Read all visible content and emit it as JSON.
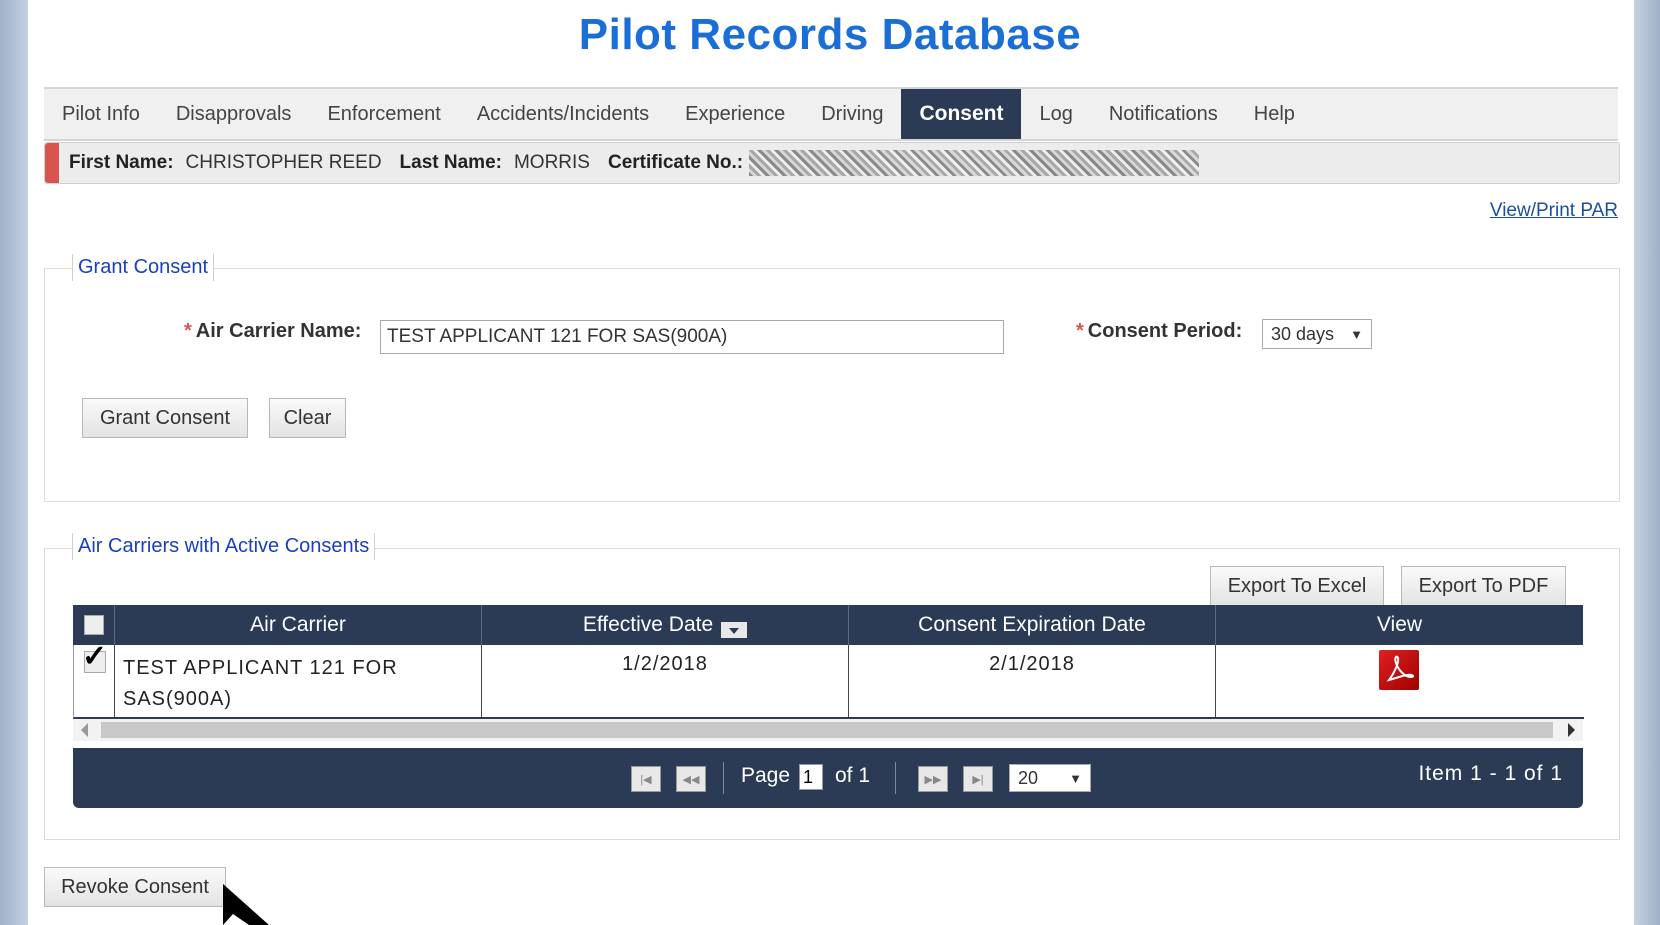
{
  "title": "Pilot Records Database",
  "nav": {
    "items": [
      "Pilot Info",
      "Disapprovals",
      "Enforcement",
      "Accidents/Incidents",
      "Experience",
      "Driving",
      "Consent",
      "Log",
      "Notifications",
      "Help"
    ],
    "active": "Consent"
  },
  "pilot": {
    "first_name_label": "First Name:",
    "first_name": "CHRISTOPHER REED",
    "last_name_label": "Last Name:",
    "last_name": "MORRIS",
    "certificate_label": "Certificate No.:"
  },
  "view_print_link": "View/Print PAR",
  "grant": {
    "legend": "Grant Consent",
    "required_mark": "*",
    "air_carrier_label": "Air Carrier Name:",
    "air_carrier_value": "TEST APPLICANT 121 FOR SAS(900A)",
    "period_label": "Consent Period:",
    "period_value": "30 days",
    "grant_button": "Grant Consent",
    "clear_button": "Clear"
  },
  "active": {
    "legend": "Air Carriers with Active Consents",
    "export_excel": "Export To Excel",
    "export_pdf": "Export To PDF",
    "columns": [
      "Air Carrier",
      "Effective Date",
      "Consent Expiration Date",
      "View"
    ],
    "rows": [
      {
        "checked": true,
        "air_carrier": "TEST APPLICANT 121 FOR SAS(900A)",
        "effective_date": "1/2/2018",
        "expiration_date": "2/1/2018",
        "view_icon": "pdf-icon"
      }
    ]
  },
  "pager": {
    "page_label": "Page",
    "page_value": "1",
    "of_label": "of 1",
    "page_size": "20",
    "item_info": "Item 1 - 1 of 1"
  },
  "revoke_button": "Revoke Consent",
  "colors": {
    "accent": "#1a6fd6",
    "header_bar": "#2b3a55",
    "info_accent": "#d9534f"
  }
}
